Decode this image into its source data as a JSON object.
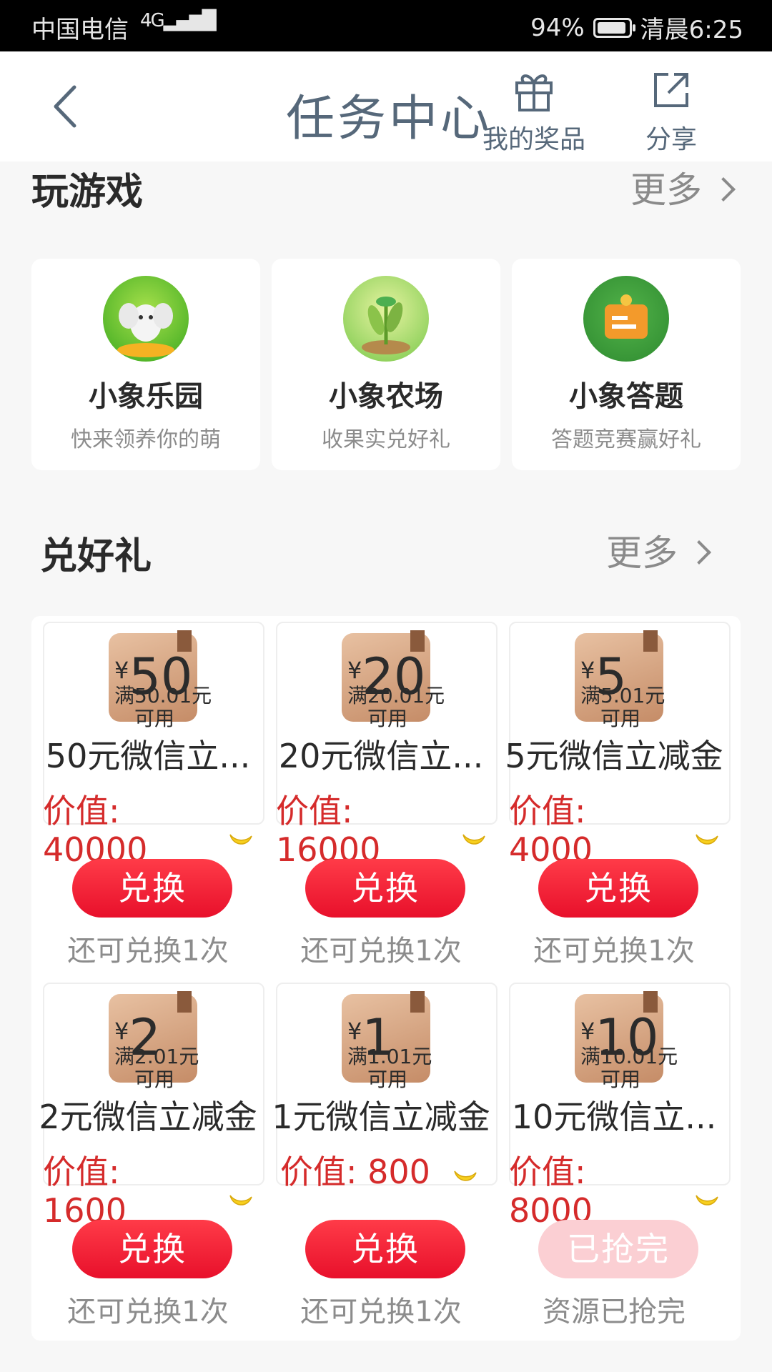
{
  "status_bar": {
    "carrier": "中国电信",
    "network": "4G",
    "battery": "94%",
    "time": "清晨6:25"
  },
  "header": {
    "title": "任务中心",
    "prizes_label": "我的奖品",
    "share_label": "分享"
  },
  "games": {
    "title": "玩游戏",
    "more": "更多",
    "items": [
      {
        "name": "小象乐园",
        "desc": "快来领养你的萌"
      },
      {
        "name": "小象农场",
        "desc": "收果实兑好礼"
      },
      {
        "name": "小象答题",
        "desc": "答题竞赛赢好礼"
      }
    ]
  },
  "exchange": {
    "title": "兑好礼",
    "more": "更多",
    "value_label": "价值:",
    "items": [
      {
        "amount": "50",
        "currency": "¥",
        "condition": "满50.01元",
        "condition2": "可用",
        "title": "50元微信立...",
        "value": "40000",
        "button": "兑换",
        "remain": "还可兑换1次"
      },
      {
        "amount": "20",
        "currency": "¥",
        "condition": "满20.01元",
        "condition2": "可用",
        "title": "20元微信立...",
        "value": "16000",
        "button": "兑换",
        "remain": "还可兑换1次"
      },
      {
        "amount": "5",
        "currency": "¥",
        "condition": "满5.01元",
        "condition2": "可用",
        "title": "5元微信立减金",
        "value": "4000",
        "button": "兑换",
        "remain": "还可兑换1次"
      },
      {
        "amount": "2",
        "currency": "¥",
        "condition": "满2.01元",
        "condition2": "可用",
        "title": "2元微信立减金",
        "value": "1600",
        "button": "兑换",
        "remain": "还可兑换1次"
      },
      {
        "amount": "1",
        "currency": "¥",
        "condition": "满1.01元",
        "condition2": "可用",
        "title": "1元微信立减金",
        "value": "800",
        "button": "兑换",
        "remain": "还可兑换1次"
      },
      {
        "amount": "10",
        "currency": "¥",
        "condition": "满10.01元",
        "condition2": "可用",
        "title": "10元微信立...",
        "value": "8000",
        "button": "已抢完",
        "remain": "资源已抢完"
      }
    ]
  }
}
